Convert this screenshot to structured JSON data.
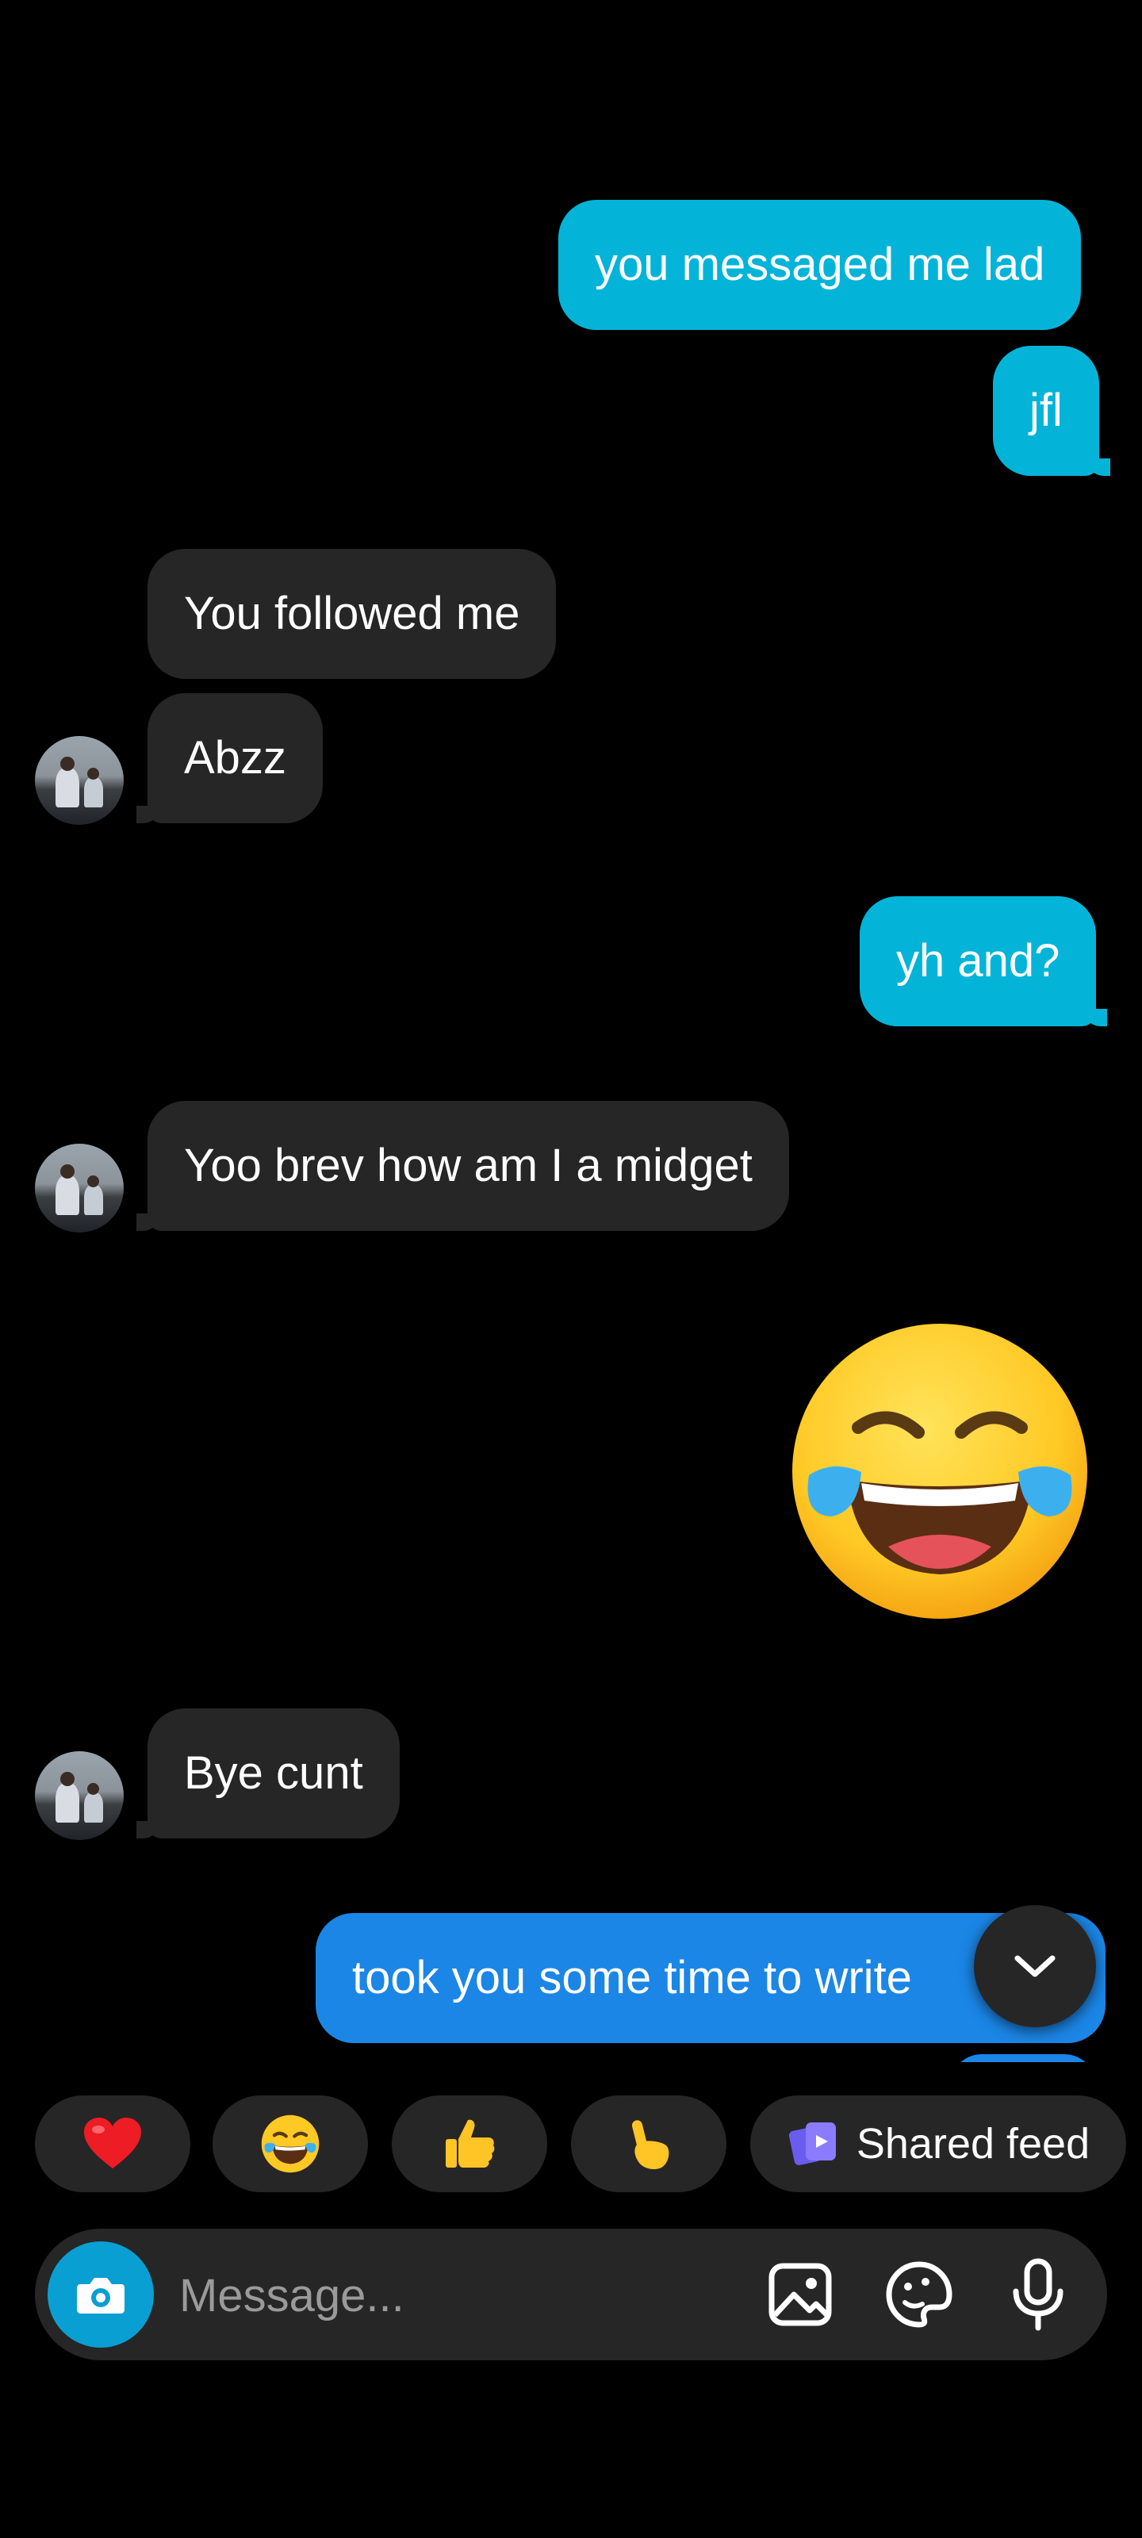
{
  "messages": [
    {
      "id": "m1",
      "from": "me",
      "text": "you messaged me lad"
    },
    {
      "id": "m2",
      "from": "me",
      "text": "jfl"
    },
    {
      "id": "m3",
      "from": "them",
      "text": "You followed me"
    },
    {
      "id": "m4",
      "from": "them",
      "text": "Abzz"
    },
    {
      "id": "m5",
      "from": "me",
      "text": "yh and?"
    },
    {
      "id": "m6",
      "from": "them",
      "text": "Yoo brev how am I a midget"
    },
    {
      "id": "m7",
      "from": "me",
      "emoji": "face-with-tears-of-joy"
    },
    {
      "id": "m8",
      "from": "them",
      "text": "Bye cunt"
    },
    {
      "id": "m9",
      "from": "me",
      "text": "took you some time to write"
    }
  ],
  "quick_reactions": [
    {
      "emoji": "red-heart",
      "glyph": "❤️"
    },
    {
      "emoji": "face-with-tears-of-joy",
      "glyph": "😂"
    },
    {
      "emoji": "thumbs-up",
      "glyph": "👍"
    },
    {
      "emoji": "pointing-hand",
      "glyph": "👆"
    }
  ],
  "shared_feed": {
    "label": "Shared feed",
    "icon": "shared-feed-icon"
  },
  "composer": {
    "placeholder": "Message...",
    "camera_icon": "camera-icon",
    "gallery_icon": "gallery-icon",
    "sticker_icon": "sticker-icon",
    "mic_icon": "microphone-icon"
  },
  "colors": {
    "sent_bubble": "#04b4d8",
    "sent_bubble_latest": "#1b86e6",
    "received_bubble": "#262626",
    "background": "#000000",
    "camera_button": "#0a9fd2"
  }
}
